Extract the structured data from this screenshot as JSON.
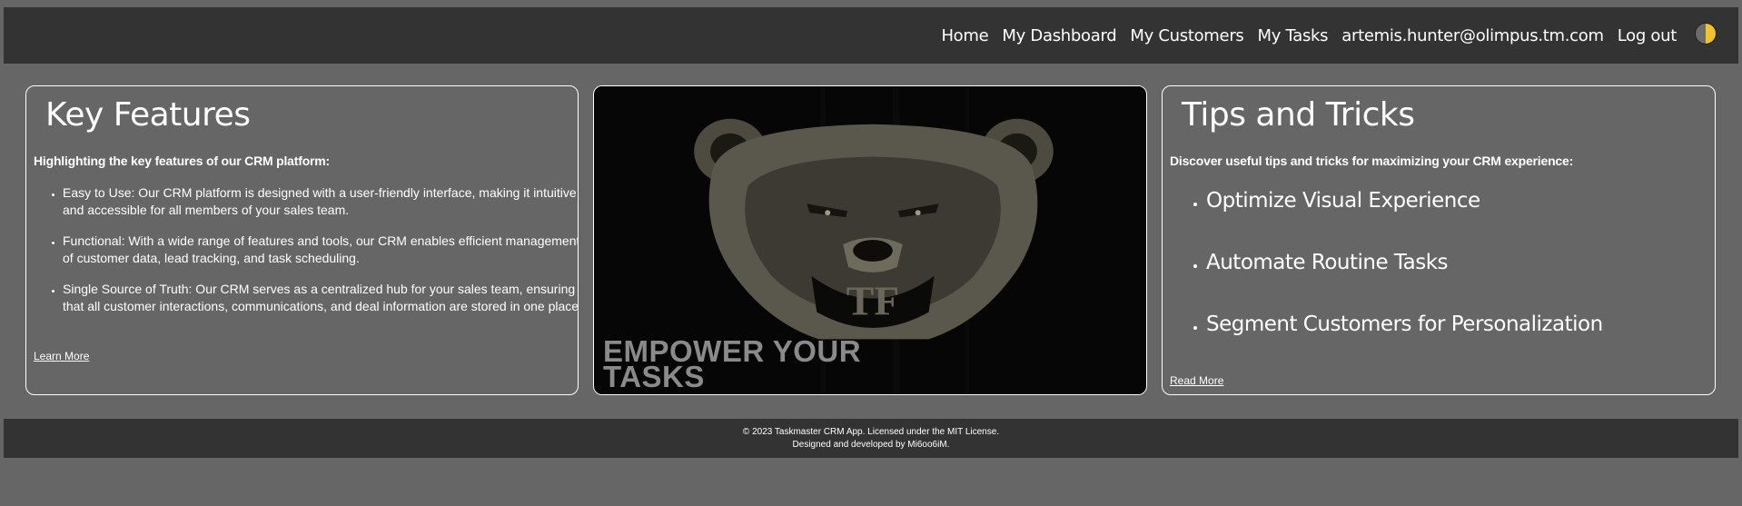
{
  "nav": {
    "links": [
      "Home",
      "My Dashboard",
      "My Customers",
      "My Tasks",
      "artemis.hunter@olimpus.tm.com",
      "Log out"
    ]
  },
  "key_features": {
    "title": "Key Features",
    "intro": "Highlighting the key features of our CRM platform:",
    "items": [
      "Easy to Use: Our CRM platform is designed with a user-friendly interface, making it intuitive and accessible for all members of your sales team.",
      "Functional: With a wide range of features and tools, our CRM enables efficient management of customer data, lead tracking, and task scheduling.",
      "Single Source of Truth: Our CRM serves as a centralized hub for your sales team, ensuring that all customer interactions, communications, and deal information are stored in one place."
    ],
    "link": "Learn More"
  },
  "banner": {
    "monogram": "TF",
    "line1": "EMPOWER YOUR",
    "line2": "TASKS"
  },
  "tips": {
    "title": "Tips and Tricks",
    "intro": "Discover useful tips and tricks for maximizing your CRM experience:",
    "items": [
      "Optimize Visual Experience",
      "Automate Routine Tasks",
      "Segment Customers for Personalization"
    ],
    "link": "Read More"
  },
  "footer": {
    "line1": "© 2023 Taskmaster CRM App. Licensed under the MIT License.",
    "line2": "Designed and developed by Mi6oo6iM."
  },
  "icons": {
    "theme_toggle": "half-moon-sun-icon",
    "banner_image": "bear-illustration"
  },
  "colors": {
    "page_bg": "#666666",
    "bar_bg": "#333333",
    "toggle_accent": "#f1c232"
  }
}
